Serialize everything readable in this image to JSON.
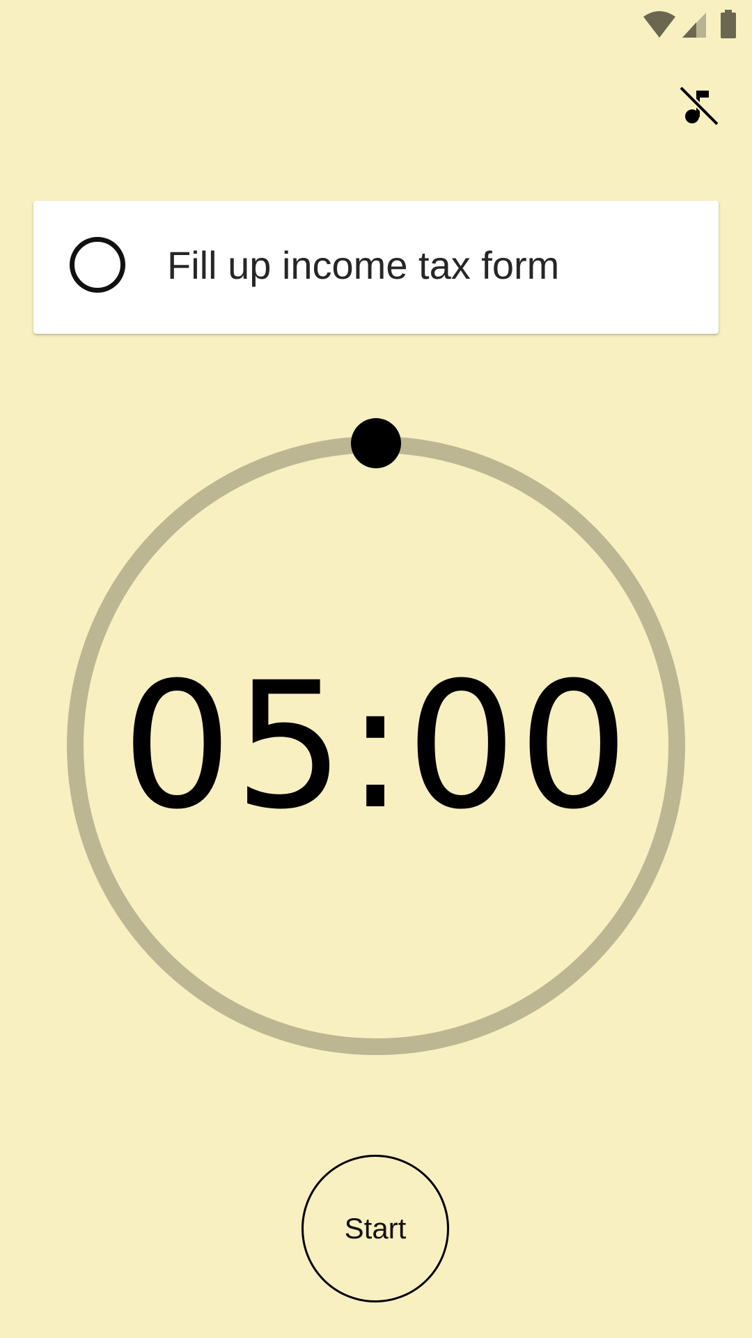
{
  "status_bar": {
    "icons": [
      "wifi-icon",
      "signal-icon",
      "battery-icon"
    ]
  },
  "toolbar": {
    "music_toggle_icon": "music-off-icon"
  },
  "task": {
    "title": "Fill up income tax form",
    "completed": false
  },
  "timer": {
    "display": "05:00",
    "progress": 0
  },
  "controls": {
    "start_label": "Start"
  },
  "colors": {
    "background": "#f8f0c1",
    "ring": "#bdb692",
    "accent": "#000000",
    "status_icons": "#6b6650"
  }
}
